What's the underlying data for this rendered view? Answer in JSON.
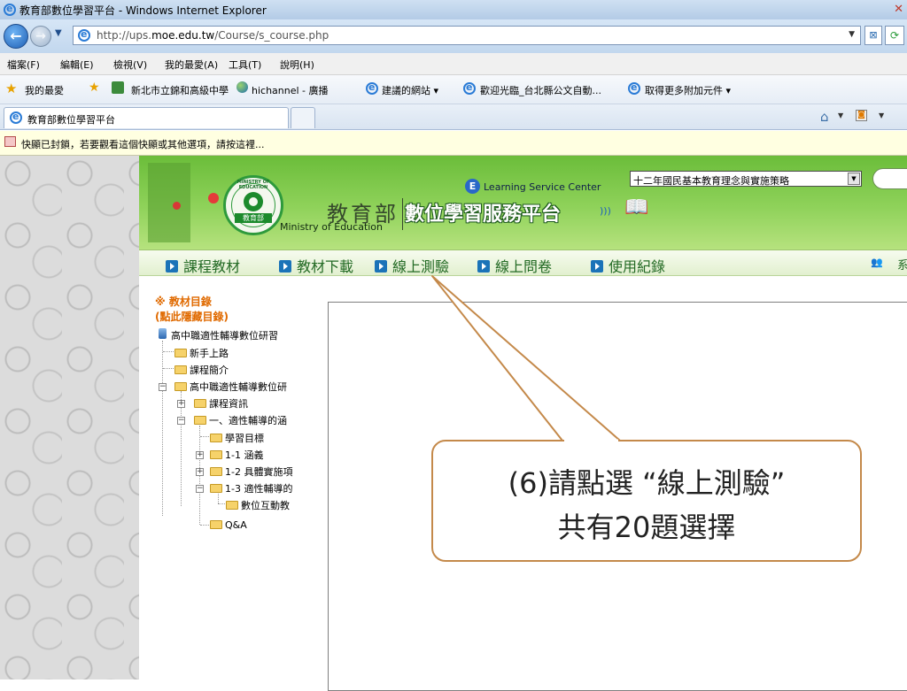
{
  "window": {
    "title": "教育部數位學習平台 - Windows Internet Explorer"
  },
  "address": {
    "url_prefix": "http://ups.",
    "url_domain": "moe.edu.tw",
    "url_path": "/Course/s_course.php"
  },
  "menu": [
    "檔案(F)",
    "編輯(E)",
    "檢視(V)",
    "我的最愛(A)",
    "工具(T)",
    "說明(H)"
  ],
  "favorites": {
    "label": "我的最愛",
    "items": [
      "新北市立錦和高級中學",
      "hichannel - 廣播",
      "建議的網站 ▾",
      "歡迎光臨_台北縣公文自動...",
      "取得更多附加元件 ▾"
    ]
  },
  "tab": {
    "title": "教育部數位學習平台"
  },
  "infobar": {
    "text": "快顯已封鎖，若要觀看這個快顯或其他選項，請按這裡..."
  },
  "banner": {
    "learning_center": "Learning Service Center",
    "moe_cn": "教育部",
    "moe_en": "Ministry of Education",
    "platform": "數位學習服務平台",
    "seal_text": "MINISTRY OF EDUCATION",
    "seal_cn": "教育部",
    "course_select": "十二年國民基本教育理念與實施策略"
  },
  "nav": [
    "課程教材",
    "教材下載",
    "線上測驗",
    "線上問卷",
    "使用紀錄"
  ],
  "nav_right": "系",
  "tree": {
    "heading": "※ 教材目錄",
    "subheading": "(點此隱藏目錄)",
    "root": "高中職適性輔導數位研習",
    "items": [
      "新手上路",
      "課程簡介",
      "高中職適性輔導數位研",
      "課程資訊",
      "一、適性輔導的涵",
      "學習目標",
      "1-1 涵義",
      "1-2 具體實施項",
      "1-3 適性輔導的",
      "數位互動教",
      "Q&A"
    ]
  },
  "callout": {
    "line1": "(6)請點選 “線上測驗”",
    "line2": "共有20題選擇"
  }
}
